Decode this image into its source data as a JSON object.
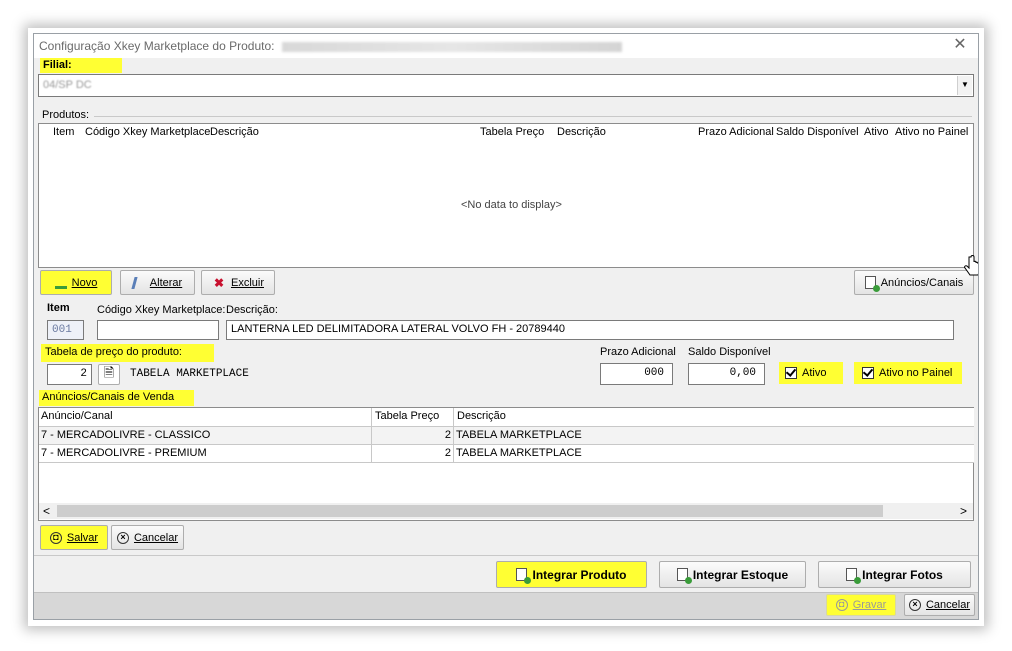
{
  "window": {
    "title": "Configuração Xkey Marketplace do Produto:",
    "close_symbol": "✕"
  },
  "filial": {
    "label": "Filial:",
    "value": "04/SP  DC"
  },
  "produtos": {
    "label": "Produtos:",
    "columns": [
      "Item",
      "Código Xkey Marketplace",
      "Descrição",
      "Tabela Preço",
      "Descrição",
      "Prazo Adicional",
      "Saldo Disponível",
      "Ativo",
      "Ativo no Painel"
    ],
    "empty_text": "<No data to display>"
  },
  "toolbar": {
    "novo": "Novo",
    "alterar": "Alterar",
    "excluir": "Excluir",
    "anuncios": "Anúncios/Canais"
  },
  "form": {
    "item_label": "Item",
    "item_value": "001",
    "codigo_label": "Código Xkey Marketplace:",
    "codigo_value": "",
    "descricao_label": "Descrição:",
    "descricao_value": "LANTERNA LED DELIMITADORA LATERAL VOLVO FH - 20789440",
    "tabela_label": "Tabela de preço do produto:",
    "tabela_code": "2",
    "tabela_name": "TABELA MARKETPLACE",
    "prazo_label": "Prazo Adicional",
    "prazo_value": "000",
    "saldo_label": "Saldo Disponível",
    "saldo_value": "0,00",
    "ativo_label": "Ativo",
    "ativo_checked": true,
    "ativo_painel_label": "Ativo no Painel",
    "ativo_painel_checked": true
  },
  "canais": {
    "label": "Anúncios/Canais de Venda",
    "columns": [
      "Anúncio/Canal",
      "Tabela Preço",
      "Descrição"
    ],
    "rows": [
      {
        "canal": "7 - MERCADOLIVRE - CLASSICO",
        "tabela": "2",
        "descricao": "TABELA MARKETPLACE"
      },
      {
        "canal": "7 - MERCADOLIVRE - PREMIUM",
        "tabela": "2",
        "descricao": "TABELA MARKETPLACE"
      }
    ],
    "scroll_left": "<",
    "scroll_right": ">"
  },
  "actions": {
    "salvar": "Salvar",
    "cancelar": "Cancelar",
    "integrar_produto": "Integrar Produto",
    "integrar_estoque": "Integrar Estoque",
    "integrar_fotos": "Integrar Fotos",
    "gravar": "Gravar",
    "cancelar_footer": "Cancelar"
  },
  "colors": {
    "highlight": "#ffff33",
    "window_bg": "#f0f0f0"
  }
}
